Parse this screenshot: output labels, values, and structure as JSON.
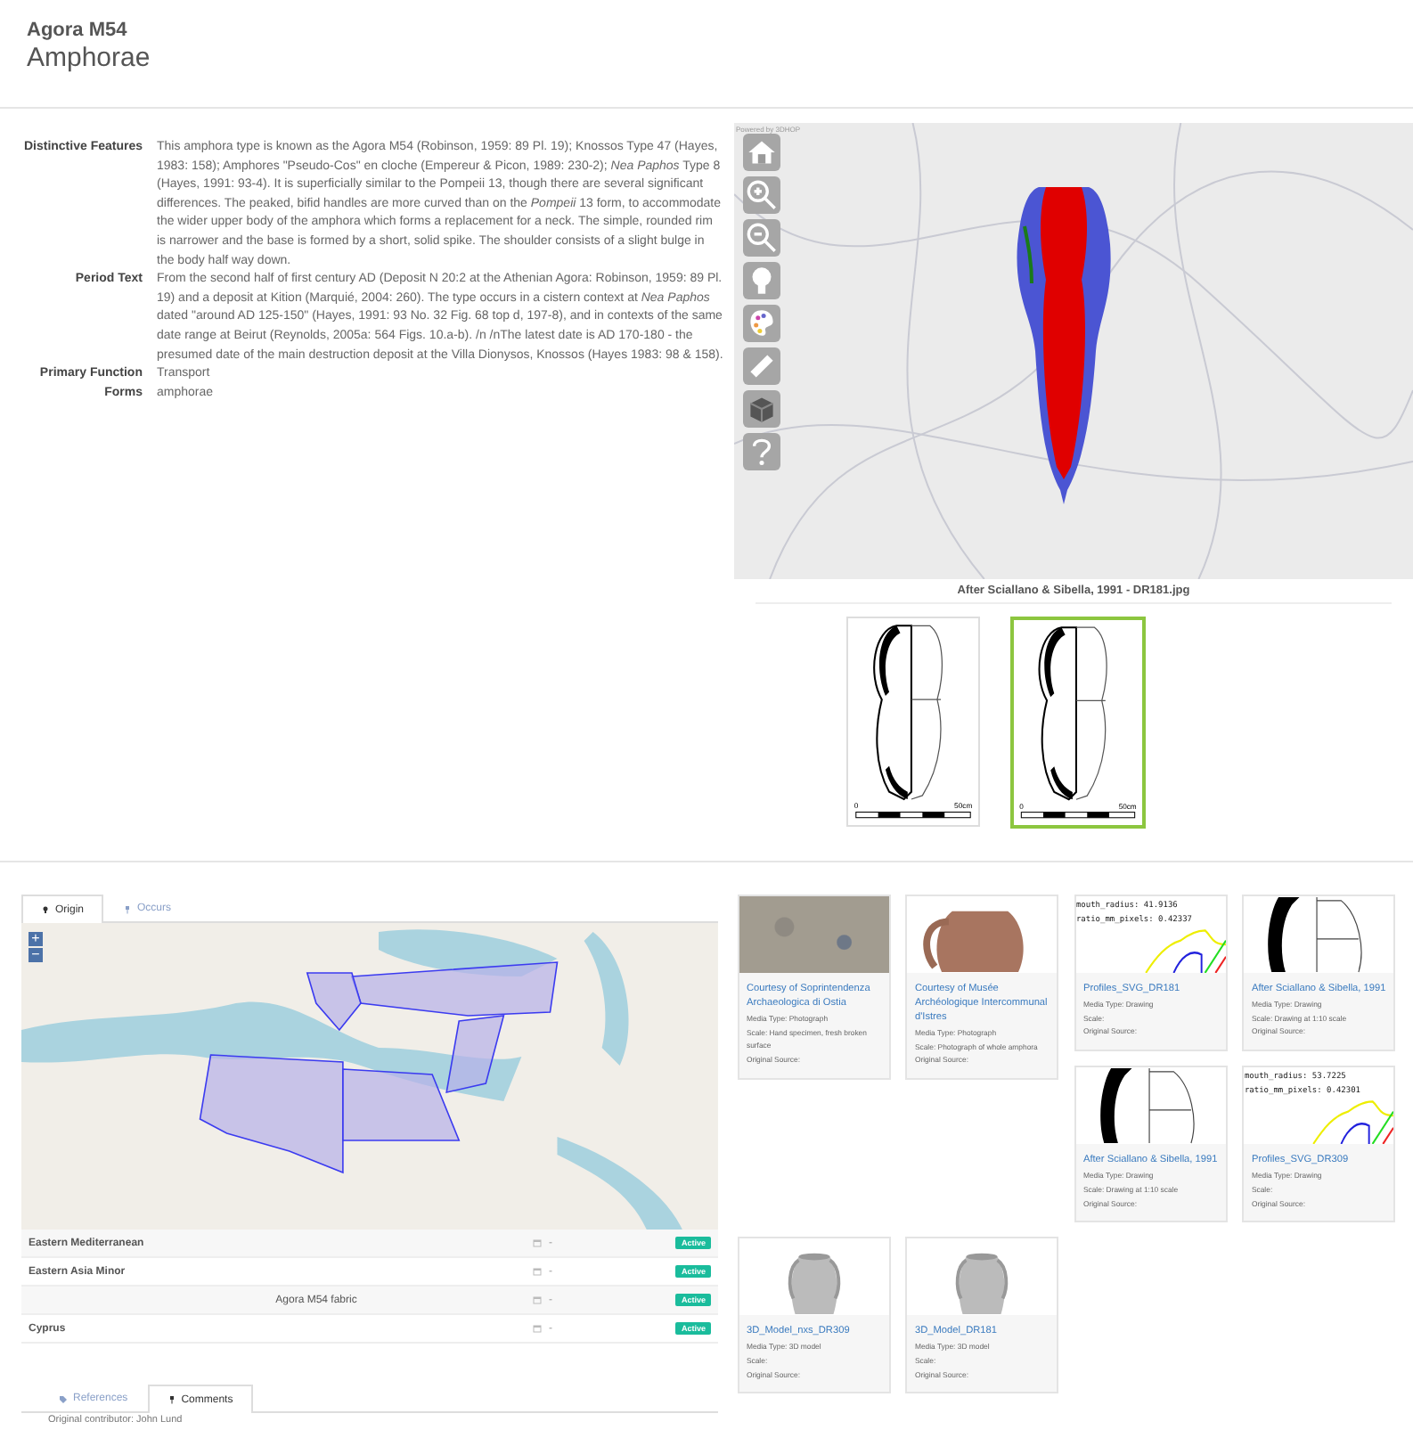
{
  "header": {
    "title": "Agora M54",
    "subtitle": "Amphorae"
  },
  "details": [
    {
      "label": "Distinctive Features",
      "text": "This amphora type is known as the Agora M54 (Robinson, 1959: 89 Pl. 19); Knossos Type 47 (Hayes, 1983: 158); Amphores \"Pseudo-Cos\" en cloche (Empereur & Picon, 1989: 230-2); *Nea Paphos* Type 8 (Hayes, 1991: 93-4). It is superficially similar to the Pompeii 13, though there are several significant differences. The peaked, bifid handles are more curved than on the *Pompeii* 13 form, to accommodate the wider upper body of the amphora which forms a replacement for a neck. The simple, rounded rim is narrower and the base is formed by a short, solid spike. The shoulder consists of a slight bulge in the body half way down."
    },
    {
      "label": "Period Text",
      "text": "From the second half of first century AD (Deposit N 20:2 at the Athenian Agora: Robinson, 1959: 89 Pl. 19) and a deposit at Kition (Marquié, 2004: 260). The type occurs in a cistern context at *Nea Paphos* dated \"around AD 125-150\" (Hayes, 1991: 93 No. 32 Fig. 68 top d, 197-8), and in contexts of the same date range at Beirut (Reynolds, 2005a: 564 Figs. 10.a-b). /n /nThe latest date is AD 170-180 - the presumed date of the main destruction deposit at the Villa Dionysos, Knossos (Hayes 1983: 98 & 158)."
    },
    {
      "label": "Primary Function",
      "text": "Transport"
    },
    {
      "label": "Forms",
      "text": "amphorae"
    }
  ],
  "viewer": {
    "credit": "Powered by 3DHOP",
    "tools": [
      {
        "kind": "home"
      },
      {
        "kind": "zoom-in"
      },
      {
        "kind": "zoom-out"
      },
      {
        "kind": "light"
      },
      {
        "kind": "palette"
      },
      {
        "kind": "measure"
      },
      {
        "kind": "cube"
      },
      {
        "kind": "help"
      }
    ]
  },
  "caption": "After Sciallano & Sibella, 1991 - DR181.jpg",
  "thumbnails": [
    {
      "selected": false,
      "scale_start": "0",
      "scale_end": "50cm"
    },
    {
      "selected": true,
      "scale_start": "0",
      "scale_end": "50cm"
    }
  ],
  "location_tabs": [
    {
      "label": "Origin",
      "selected": true
    },
    {
      "label": "Occurs",
      "selected": false
    }
  ],
  "map": {
    "zoom_in": "+",
    "zoom_out": "−"
  },
  "locations": [
    {
      "kind": "region",
      "name": "Eastern Mediterranean",
      "date": "-",
      "status": "Active"
    },
    {
      "kind": "region",
      "name": "Eastern Asia Minor",
      "date": "-",
      "status": "Active"
    },
    {
      "kind": "fabric",
      "name": "Agora M54 fabric",
      "date": "-",
      "status": "Active"
    },
    {
      "kind": "region",
      "name": "Cyprus",
      "date": "-",
      "status": "Active"
    }
  ],
  "media": [
    {
      "kind": "stone",
      "title": "Courtesy of Soprintendenza Archaeologica di Ostia",
      "lines": [
        "Media Type: Photograph",
        "Scale: Hand specimen, fresh broken surface",
        "Original Source:"
      ]
    },
    {
      "kind": "jug",
      "title": "Courtesy of Musée Archéologique Intercommunal d'Istres",
      "lines": [
        "Media Type: Photograph",
        "Scale: Photograph of whole amphora",
        "Original Source:"
      ]
    },
    {
      "kind": "profile",
      "title": "Profiles_SVG_DR181",
      "overlay": [
        "mouth_radius: 41.9136",
        "ratio_mm_pixels: 0.42337"
      ],
      "lines": [
        "Media Type: Drawing",
        "Scale:",
        "Original Source:"
      ]
    },
    {
      "kind": "drawing",
      "title": "After Sciallano & Sibella, 1991",
      "lines": [
        "Media Type: Drawing",
        "Scale: Drawing at 1:10 scale",
        "Original Source:"
      ]
    },
    {
      "kind": "drawing",
      "title": "After Sciallano & Sibella, 1991",
      "lines": [
        "Media Type: Drawing",
        "Scale: Drawing at 1:10 scale",
        "Original Source:"
      ]
    },
    {
      "kind": "profile",
      "title": "Profiles_SVG_DR309",
      "overlay": [
        "mouth_radius: 53.7225",
        "ratio_mm_pixels: 0.42301"
      ],
      "lines": [
        "Media Type: Drawing",
        "Scale:",
        "Original Source:"
      ]
    },
    {
      "kind": "model",
      "title": "3D_Model_nxs_DR309",
      "lines": [
        "Media Type: 3D model",
        "Scale:",
        "Original Source:"
      ]
    },
    {
      "kind": "model",
      "title": "3D_Model_DR181",
      "lines": [
        "Media Type: 3D model",
        "Scale:",
        "Original Source:"
      ]
    }
  ],
  "bottom_tabs": [
    {
      "label": "References",
      "selected": false
    },
    {
      "label": "Comments",
      "selected": true
    }
  ],
  "comment": "Original contributor: John Lund"
}
